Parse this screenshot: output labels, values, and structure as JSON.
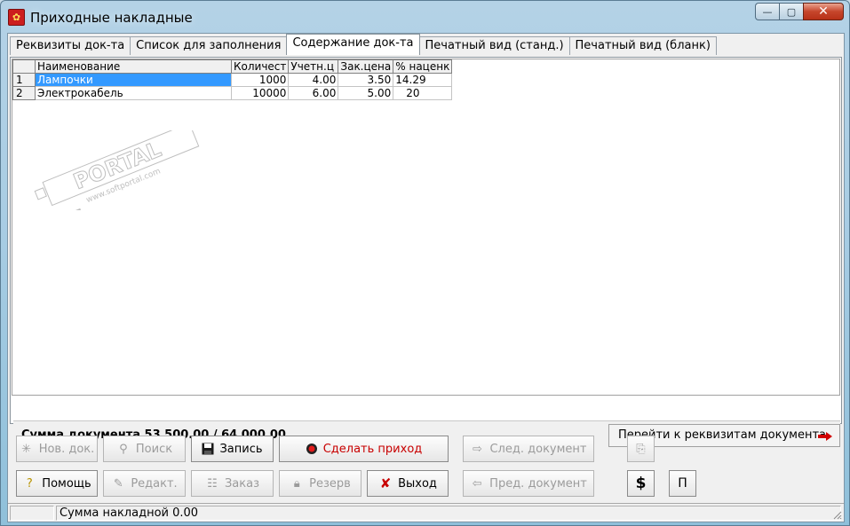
{
  "window": {
    "title": "Приходные накладные",
    "app_icon_glyph": "✿",
    "controls": {
      "minimize": "—",
      "maximize": "▢",
      "close": "✕"
    }
  },
  "tabs": [
    {
      "label": "Реквизиты док-та",
      "active": false
    },
    {
      "label": "Список для заполнения",
      "active": false
    },
    {
      "label": "Содержание док-та",
      "active": true
    },
    {
      "label": "Печатный вид (станд.)",
      "active": false
    },
    {
      "label": "Печатный вид (бланк)",
      "active": false
    }
  ],
  "grid": {
    "columns": [
      "Наименование",
      "Количест",
      "Учетн.ц",
      "Зак.цена",
      "% наценк"
    ],
    "rows": [
      {
        "n": "1",
        "name": "Лампочки",
        "qty": "1000",
        "acc_price": "4.00",
        "buy_price": "3.50",
        "markup": "14.29",
        "selected": true
      },
      {
        "n": "2",
        "name": "Электрокабель",
        "qty": "10000",
        "acc_price": "6.00",
        "buy_price": "5.00",
        "markup": "20",
        "selected": false
      }
    ]
  },
  "watermark": {
    "text": "PORTAL",
    "subtext": "www.softportal.com",
    "mark": "™"
  },
  "summary": {
    "document_sum": "Сумма документа 53 500.00 / 64 000.00",
    "goto_label": "Перейти к реквизитам документа"
  },
  "buttons": {
    "new_doc": "Нов. док.",
    "search": "Поиск",
    "save": "Запись",
    "make_receipt": "Сделать приход",
    "next_doc": "След. документ",
    "help": "Помощь",
    "edit": "Редакт.",
    "order": "Заказ",
    "reserve": "Резерв",
    "exit": "Выход",
    "prev_doc": "Пред. документ",
    "dollar": "$",
    "p": "П"
  },
  "statusbar": {
    "text": "Сумма накладной 0.00"
  },
  "colors": {
    "selection": "#3399ff",
    "accent_red": "#c80000",
    "frame": "#a9cde4"
  }
}
